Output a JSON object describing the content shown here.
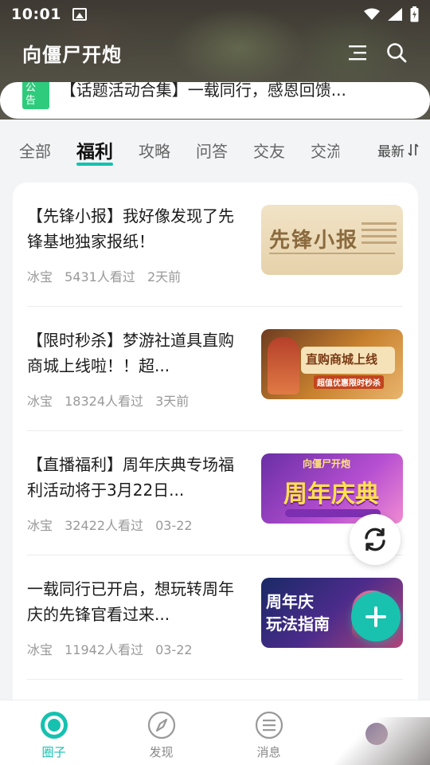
{
  "status_bar": {
    "time": "10:01"
  },
  "header": {
    "title": "向僵尸开炮",
    "menu_icon": "menu-lines-icon",
    "search_icon": "search-icon"
  },
  "notice": {
    "badge": "公告",
    "text": "【话题活动合集】一载同行，感恩回馈..."
  },
  "tabs": {
    "items": [
      "全部",
      "福利",
      "攻略",
      "问答",
      "交友",
      "交流"
    ],
    "active": "福利",
    "sort_label": "最新"
  },
  "posts": [
    {
      "title": "【先锋小报】我好像发现了先锋基地独家报纸！",
      "author": "冰宝",
      "views": "5431人看过",
      "time": "2天前",
      "thumb_text": "先锋小报"
    },
    {
      "title": "【限时秒杀】梦游社道具直购商城上线啦！！超...",
      "author": "冰宝",
      "views": "18324人看过",
      "time": "3天前",
      "thumb_text": "直购商城上线",
      "thumb_sub": "超值优惠限时秒杀"
    },
    {
      "title": "【直播福利】周年庆典专场福利活动将于3月22日...",
      "author": "冰宝",
      "views": "32422人看过",
      "time": "03-22",
      "thumb_text": "周年庆典",
      "thumb_sub": "向僵尸开炮"
    },
    {
      "title": "一载同行已开启，想玩转周年庆的先锋官看过来...",
      "author": "冰宝",
      "views": "11942人看过",
      "time": "03-22",
      "thumb_text": "周年庆",
      "thumb_sub": "玩法指南"
    }
  ],
  "bottom_nav": {
    "items": [
      {
        "label": "圈子",
        "icon": "circle-ring-icon"
      },
      {
        "label": "发现",
        "icon": "compass-icon"
      },
      {
        "label": "消息",
        "icon": "message-list-icon"
      }
    ],
    "active": "圈子"
  },
  "colors": {
    "accent": "#16c1b0",
    "badge": "#2ecb7c",
    "fab": "#19c2ae"
  }
}
